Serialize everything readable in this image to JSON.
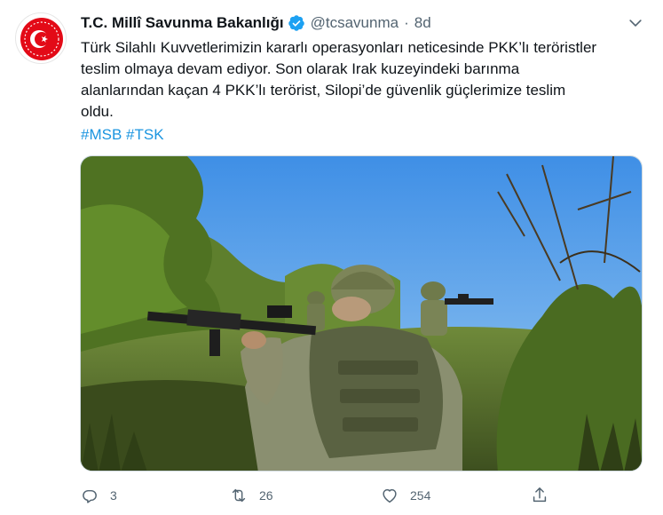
{
  "tweet": {
    "author_name": "T.C. Millî Savunma Bakanlığı",
    "handle": "@tcsavunma",
    "separator": "·",
    "time": "8d",
    "text_lines": [
      "Türk Silahlı Kuvvetlerimizin kararlı operasyonları neticesinde PKK’lı teröristler",
      "teslim olmaya devam ediyor. Son olarak Irak kuzeyindeki barınma",
      "alanlarından kaçan 4 PKK’lı terörist, Silopi’de güvenlik güçlerimize teslim",
      "oldu."
    ],
    "hashtags": [
      "#MSB",
      "#TSK"
    ],
    "media_icon": "photo-soldiers-aiming-rifles"
  },
  "actions": {
    "reply_count": "3",
    "retweet_count": "26",
    "like_count": "254"
  },
  "icons": {
    "verified": "verified-badge-icon",
    "more": "chevron-down-icon",
    "reply": "reply-icon",
    "retweet": "retweet-icon",
    "like": "heart-icon",
    "share": "share-icon"
  },
  "colors": {
    "link": "#1b95e0",
    "secondary_text": "#536471",
    "verified": "#1da1f2",
    "emblem_red": "#e30a17"
  }
}
